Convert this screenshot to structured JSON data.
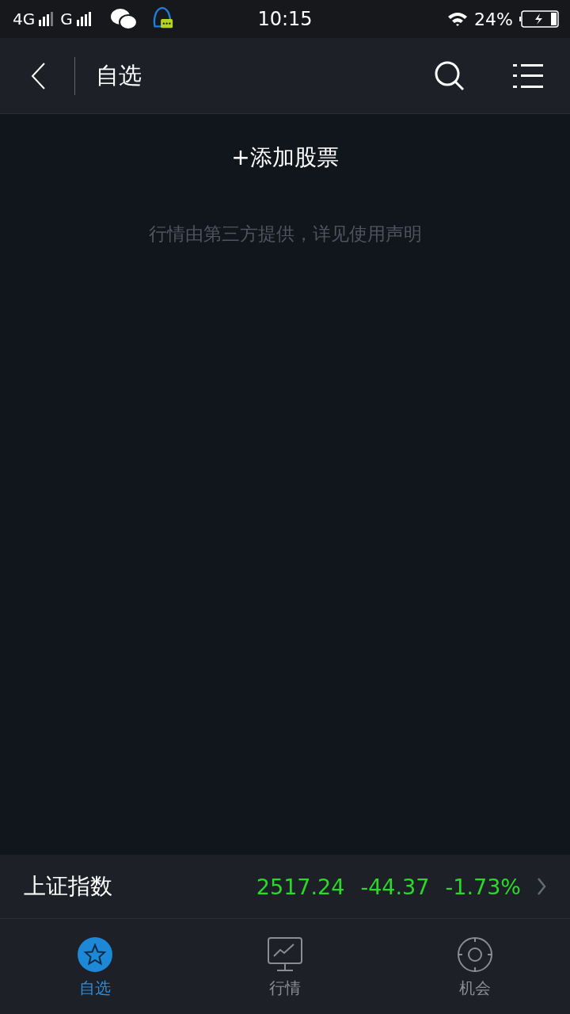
{
  "status_bar": {
    "networks": [
      "4G",
      "G"
    ],
    "time": "10:15",
    "battery_text": "24%"
  },
  "header": {
    "title": "自选"
  },
  "content": {
    "add_button": "+添加股票",
    "notice": "行情由第三方提供，详见使用声明"
  },
  "index_bar": {
    "name": "上证指数",
    "value": "2517.24",
    "change": "-44.37",
    "percent": "-1.73%"
  },
  "tabs": [
    {
      "label": "自选",
      "kind": "star",
      "selected": true
    },
    {
      "label": "行情",
      "kind": "chart",
      "selected": false
    },
    {
      "label": "机会",
      "kind": "target",
      "selected": false
    }
  ]
}
